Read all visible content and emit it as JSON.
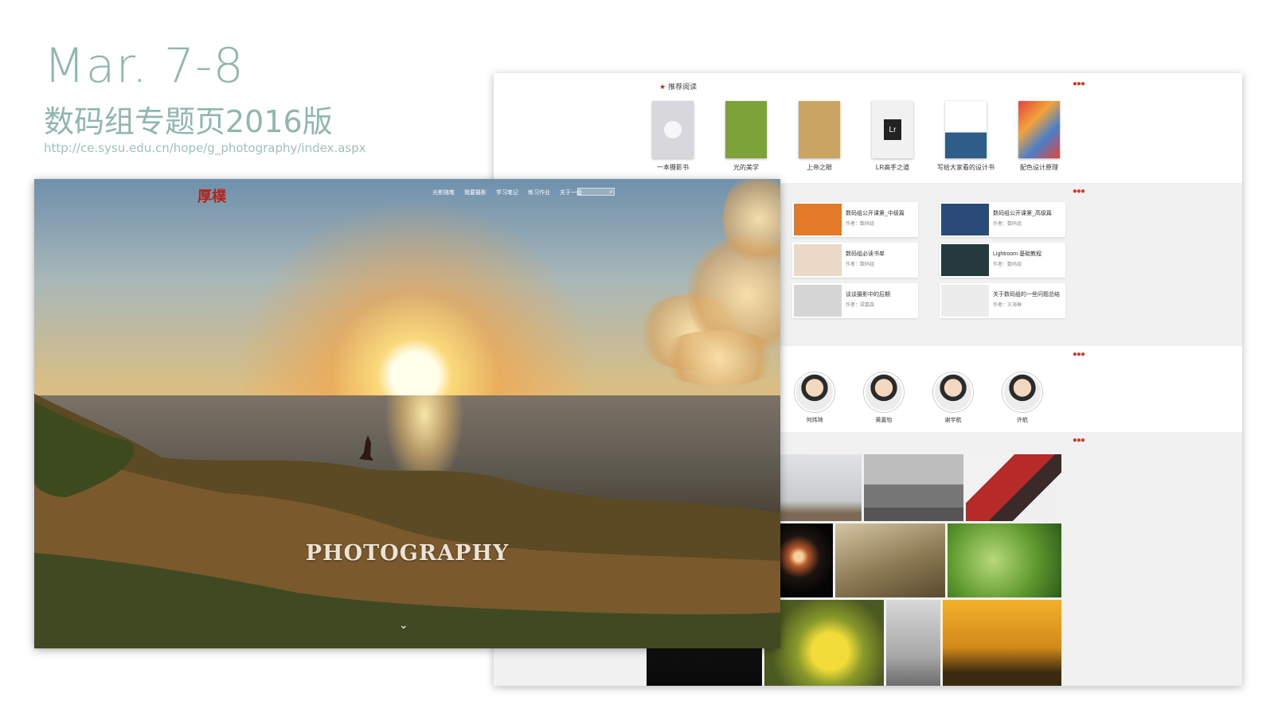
{
  "slide": {
    "title": "Mar. 7-8",
    "subtitle": "数码组专题页2016版",
    "url": "http://ce.sysu.edu.cn/hope/g_photography/index.aspx"
  },
  "hero": {
    "logo": "厚樸",
    "nav": [
      "光影随笔",
      "我要摄影",
      "学习笔记",
      "练习作业",
      "关于一组"
    ],
    "search_placeholder": "",
    "search_icon": "magnifier-icon",
    "brand": "PHOTOGRAPHY",
    "scroll_icon": "chevron-down-icon"
  },
  "books": {
    "heading": "推荐阅读",
    "items": [
      {
        "title": "一本摄影书",
        "color": "#d8d8dc"
      },
      {
        "title": "光的美学",
        "color": "#7da23a"
      },
      {
        "title": "上帝之眼",
        "color": "#c9a463"
      },
      {
        "title": "LR高手之道",
        "color": "#f1f1f1"
      },
      {
        "title": "写给大家看的设计书",
        "color": "#2f5d8a"
      },
      {
        "title": "配色设计原理",
        "color": "#e3443a"
      }
    ]
  },
  "articles": [
    {
      "title": "数码组公开课第_中级篇",
      "author": "作者：数码组",
      "thumb": "#e27a2a"
    },
    {
      "title": "数码组公开课第_高级篇",
      "author": "作者：数码组",
      "thumb": "#2a4a77"
    },
    {
      "title": "数码组必读书单",
      "author": "作者：数码组",
      "thumb": "#ead9c6"
    },
    {
      "title": "Lightroom 基础教程",
      "author": "作者：数码组",
      "thumb": "#243a3f"
    },
    {
      "title": "谈谈摄影中的后期",
      "author": "作者：梁嘉森",
      "thumb": "#d6d6d6"
    },
    {
      "title": "关于数码组的一些问题总结",
      "author": "作者：王海琳",
      "thumb": "#ececec"
    }
  ],
  "members": [
    "何炜琦",
    "黄嘉怡",
    "谢宇航",
    "许航"
  ],
  "gallery_icons": [
    "seagull-photo",
    "city-skyline-photo",
    "festival-photo",
    "fireworks-photo",
    "flower-photo",
    "green-leaf-photo",
    "bee-photo",
    "tree-silhouette-photo",
    "hikers-photo",
    "dark-thumbnail-photo"
  ],
  "colors": {
    "title": "#8fb7ae",
    "accent": "#c0281a"
  }
}
